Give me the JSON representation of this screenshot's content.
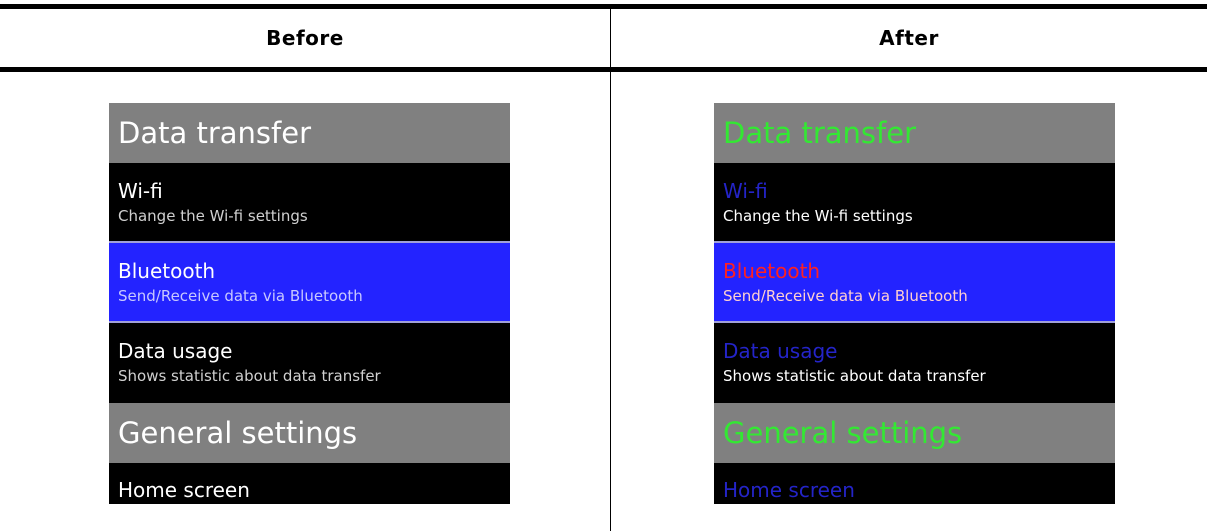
{
  "header": {
    "before_label": "Before",
    "after_label": "After"
  },
  "menu": {
    "sections": [
      {
        "title": "Data transfer",
        "items": [
          {
            "title": "Wi-fi",
            "subtitle": "Change the Wi-fi settings"
          },
          {
            "title": "Bluetooth",
            "subtitle": "Send/Receive data via Bluetooth"
          },
          {
            "title": "Data usage",
            "subtitle": "Shows statistic about data transfer"
          }
        ]
      },
      {
        "title": "General settings",
        "items": [
          {
            "title": "Home screen"
          }
        ]
      }
    ],
    "selected_item": "Bluetooth"
  },
  "colors": {
    "section_background": "#808080",
    "item_background": "#000000",
    "selected_background": "#2323ff",
    "before_section_text": "#ffffff",
    "before_item_text": "#ffffff",
    "after_section_text": "#33e833",
    "after_item_title": "#2424c8",
    "after_item_subtitle": "#ffffff",
    "after_selected_title": "#ff2020"
  }
}
